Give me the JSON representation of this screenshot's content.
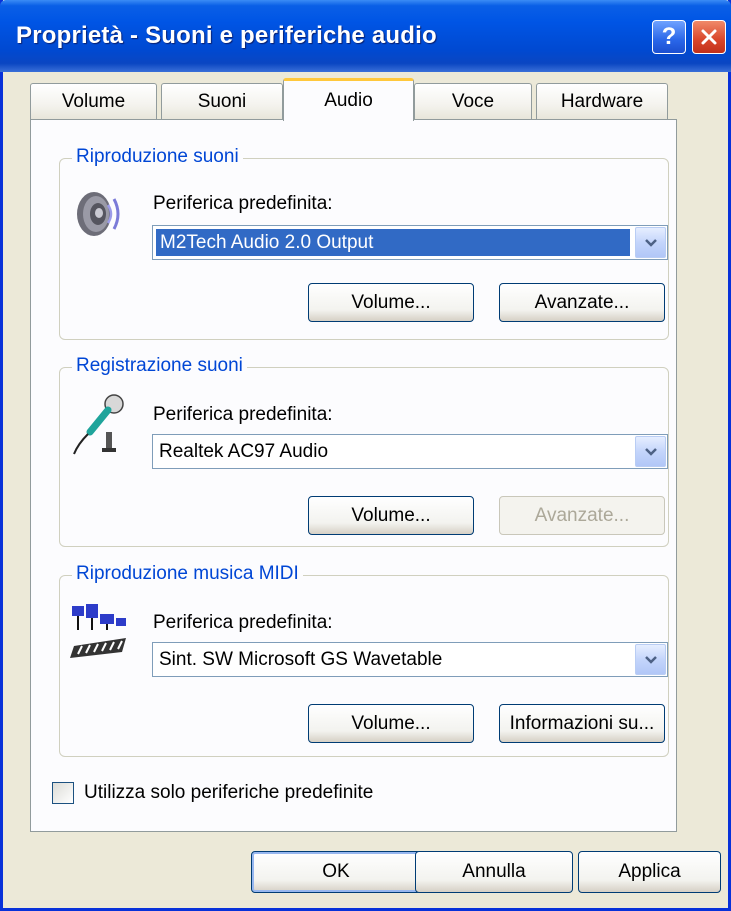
{
  "window": {
    "title": "Proprietà - Suoni e periferiche audio",
    "help_label": "?",
    "close_label": "X"
  },
  "tabs": [
    {
      "label": "Volume",
      "active": false
    },
    {
      "label": "Suoni",
      "active": false
    },
    {
      "label": "Audio",
      "active": true
    },
    {
      "label": "Voce",
      "active": false
    },
    {
      "label": "Hardware",
      "active": false
    }
  ],
  "groups": {
    "playback": {
      "title": "Riproduzione suoni",
      "device_label": "Periferica predefinita:",
      "device_value": "M2Tech Audio 2.0 Output",
      "icon": "speaker-icon",
      "volume_label": "Volume...",
      "advanced_label": "Avanzate...",
      "advanced_enabled": true
    },
    "recording": {
      "title": "Registrazione suoni",
      "device_label": "Periferica predefinita:",
      "device_value": "Realtek AC97 Audio",
      "icon": "microphone-icon",
      "volume_label": "Volume...",
      "advanced_label": "Avanzate...",
      "advanced_enabled": false
    },
    "midi": {
      "title": "Riproduzione musica MIDI",
      "device_label": "Periferica predefinita:",
      "device_value": "Sint. SW Microsoft GS Wavetable",
      "icon": "midi-keyboard-icon",
      "volume_label": "Volume...",
      "info_label": "Informazioni su..."
    }
  },
  "checkbox": {
    "label": "Utilizza solo periferiche predefinite",
    "checked": false
  },
  "buttons": {
    "ok": "OK",
    "cancel": "Annulla",
    "apply": "Applica"
  },
  "colors": {
    "titlebar": "#0055e5",
    "group_label": "#0046d5",
    "selection": "#316ac5",
    "active_tab_accent": "#ffc83c"
  }
}
